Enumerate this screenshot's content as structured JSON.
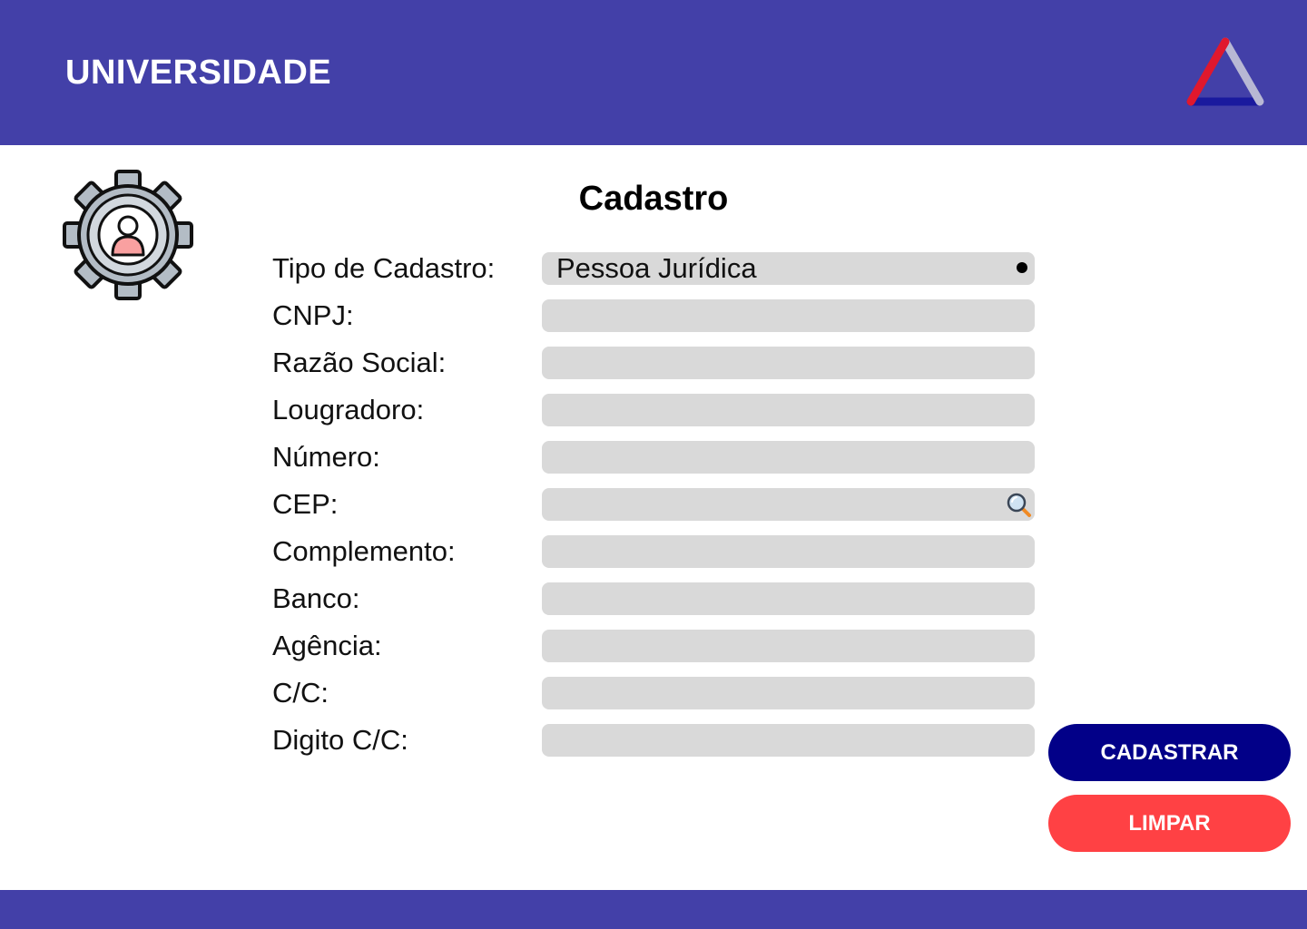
{
  "header": {
    "brand": "UNIVERSIDADE",
    "background_color": "#4340A8",
    "logo_icon": "triangle-logo-icon"
  },
  "form": {
    "title": "Cadastro",
    "fields": [
      {
        "label": "Tipo de Cadastro:",
        "value": "Pessoa Jurídica",
        "type": "select"
      },
      {
        "label": "CNPJ:",
        "value": "",
        "type": "text"
      },
      {
        "label": "Razão Social:",
        "value": "",
        "type": "text"
      },
      {
        "label": "Lougradoro:",
        "value": "",
        "type": "text"
      },
      {
        "label": "Número:",
        "value": "",
        "type": "text"
      },
      {
        "label": "CEP:",
        "value": "",
        "type": "search"
      },
      {
        "label": "Complemento:",
        "value": "",
        "type": "text"
      },
      {
        "label": "Banco:",
        "value": "",
        "type": "text"
      },
      {
        "label": "Agência:",
        "value": "",
        "type": "text"
      },
      {
        "label": "C/C:",
        "value": "",
        "type": "text"
      },
      {
        "label": "Digito C/C:",
        "value": "",
        "type": "text"
      }
    ],
    "field_color": "#D9D9D9"
  },
  "actions": {
    "submit_label": "CADASTRAR",
    "submit_color": "#020088",
    "clear_label": "LIMPAR",
    "clear_color": "#FF4144"
  },
  "icons": {
    "settings": "user-gear-icon",
    "search": "search-icon"
  }
}
